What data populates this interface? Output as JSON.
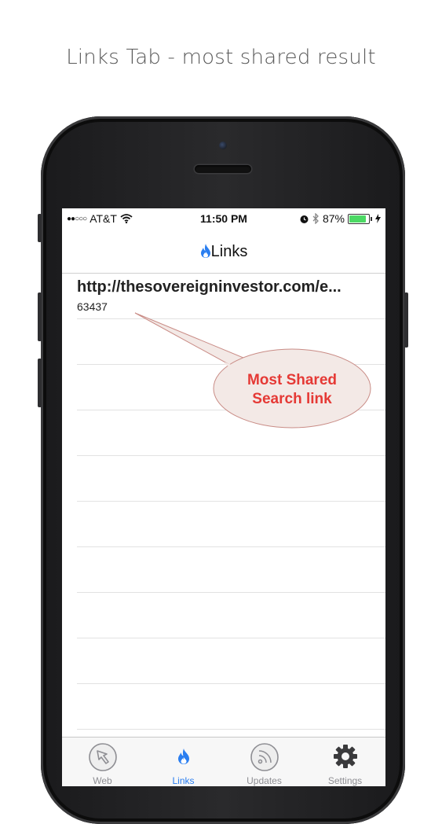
{
  "caption": "Links Tab - most shared result",
  "status_bar": {
    "carrier": "AT&T",
    "time": "11:50 PM",
    "battery": "87%",
    "battery_level": 0.87
  },
  "nav": {
    "title": "Links"
  },
  "links": [
    {
      "url": "http://thesovereigninvestor.com/e...",
      "count": "63437"
    }
  ],
  "empty_rows": 9,
  "callout": {
    "line1": "Most Shared",
    "line2": "Search link"
  },
  "tabs": [
    {
      "label": "Web",
      "icon": "globe-cursor-icon",
      "active": false
    },
    {
      "label": "Links",
      "icon": "flame-icon",
      "active": true
    },
    {
      "label": "Updates",
      "icon": "rss-icon",
      "active": false
    },
    {
      "label": "Settings",
      "icon": "gear-icon",
      "active": false
    }
  ],
  "colors": {
    "accent": "#2a7ef0",
    "callout_text": "#e53935",
    "callout_fill": "#f3e9e6"
  }
}
